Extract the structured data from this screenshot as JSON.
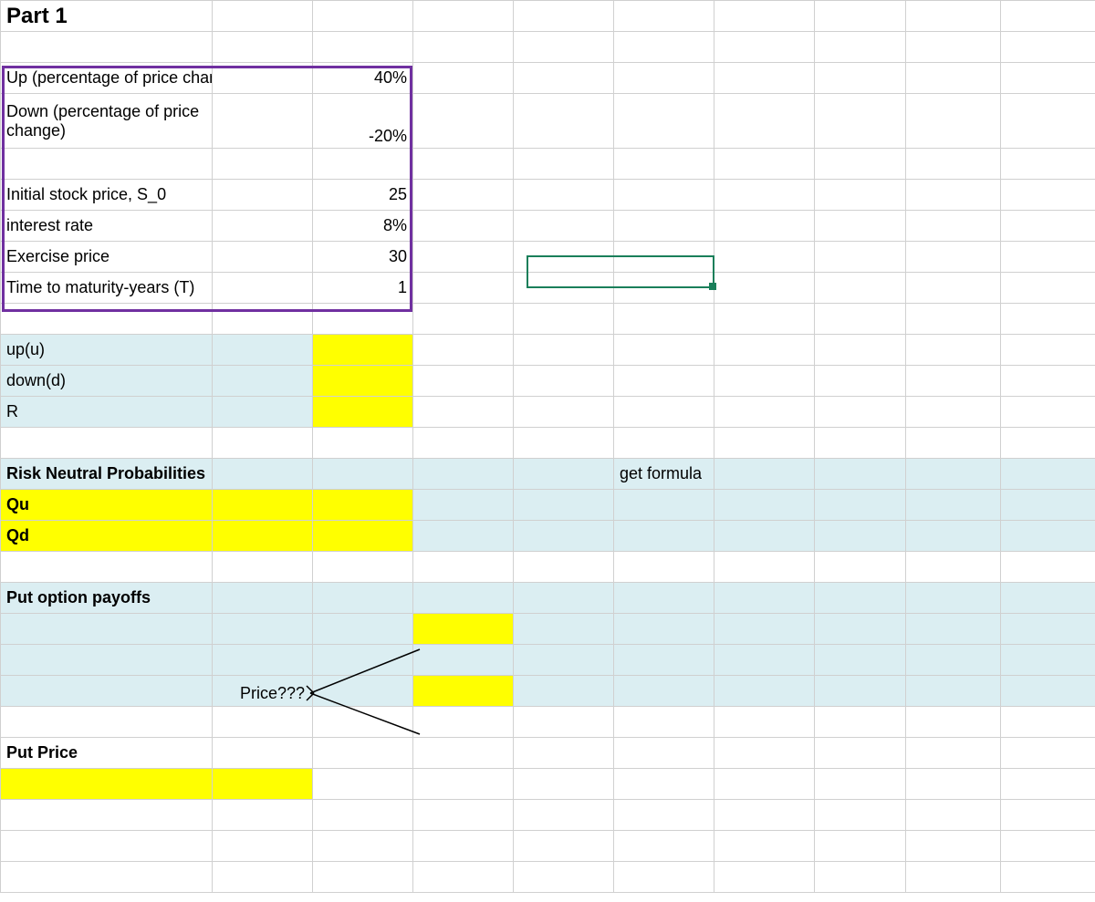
{
  "title": "Part 1",
  "inputs": {
    "up_label": "Up (percentage of price change)",
    "up_value": "40%",
    "down_label": "Down (percentage of price change)",
    "down_value": "-20%",
    "s0_label": "Initial stock price, S_0",
    "s0_value": "25",
    "rate_label": "interest rate",
    "rate_value": "8%",
    "strike_label": "Exercise price",
    "strike_value": "30",
    "time_label": "Time to maturity-years (T)",
    "time_value": "1"
  },
  "calc": {
    "upu": "up(u)",
    "downd": "down(d)",
    "R": "R"
  },
  "risk": {
    "header": "Risk Neutral Probabilities",
    "qu": "Qu",
    "qd": "Qd",
    "get_formula": "get formula"
  },
  "payoffs": {
    "header": "Put option payoffs",
    "price_label": "Price???"
  },
  "putprice": {
    "header": "Put Price"
  }
}
